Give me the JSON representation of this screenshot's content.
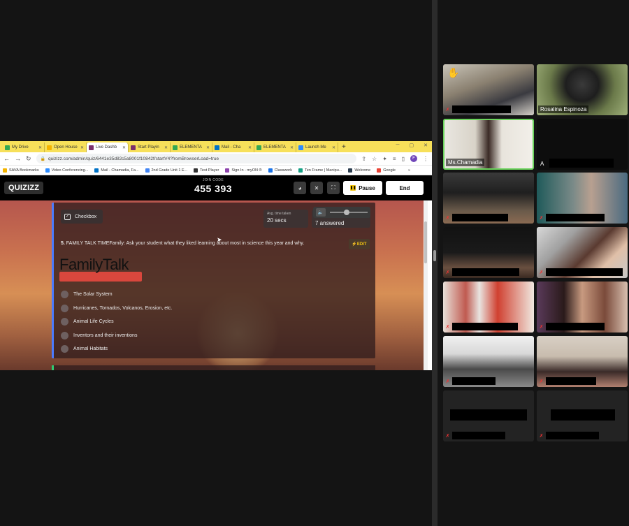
{
  "browser": {
    "tabs": [
      {
        "label": "My Drive",
        "color": "#34a853",
        "active": false
      },
      {
        "label": "Open House",
        "color": "#f4b400",
        "active": false
      },
      {
        "label": "Live Dashb",
        "color": "#7b2f6b",
        "active": true
      },
      {
        "label": "Start Playin",
        "color": "#7b2f6b",
        "active": false
      },
      {
        "label": "ELEMENTA",
        "color": "#34a853",
        "active": false
      },
      {
        "label": "Mail - Cha",
        "color": "#0072c6",
        "active": false
      },
      {
        "label": "ELEMENTA",
        "color": "#34a853",
        "active": false
      },
      {
        "label": "Launch Me",
        "color": "#2d8cff",
        "active": false
      }
    ],
    "new_tab": "+",
    "url": "quizizz.com/admin/quiz/6441e35d82c5a8001f10842f/startV4?fromBrowserLoad=true",
    "profile_initial": "F",
    "bookmarks": [
      {
        "label": "SAVA Bookmarks",
        "color": "#f4b400"
      },
      {
        "label": "Video Conferencing...",
        "color": "#2d8cff"
      },
      {
        "label": "Mail - Chamadia, Fa...",
        "color": "#0072c6"
      },
      {
        "label": "2nd Grade Unit 1 E...",
        "color": "#4285f4"
      },
      {
        "label": "Test Player",
        "color": "#333333"
      },
      {
        "label": "Sign In - myON ®",
        "color": "#8e44ad"
      },
      {
        "label": "Classwork",
        "color": "#1a73e8"
      },
      {
        "label": "Ten Frame | Manipu...",
        "color": "#16a085"
      },
      {
        "label": "Welcome",
        "color": "#2c3e50"
      },
      {
        "label": "Google",
        "color": "#ea4335"
      },
      {
        "label": "»",
        "color": "#ffffff"
      }
    ]
  },
  "quizizz": {
    "logo": "QUIZIZZ",
    "join_label": "JOIN CODE",
    "join_code": "455 393",
    "pause_label": "Pause",
    "end_label": "End",
    "question_type": "Checkbox",
    "avg_label": "Avg. time taken",
    "avg_value": "20 secs",
    "answered": "7 answered",
    "question_number": "5.",
    "question_text": "FAMILY TALK TIMEFamily: Ask your student what they liked learning about most in science this year and why.",
    "edit_label": "EDIT",
    "image_title": "FamilyTalk",
    "options": [
      "The Solar System",
      "Hurricanes, Tornados, Volcanos, Erosion, etc.",
      "Animal Life Cycles",
      "Inventors and their inventions",
      "Animal Habitats"
    ]
  },
  "gallery": {
    "participants": [
      {
        "name": "",
        "hand": true
      },
      {
        "name": "Rosalina Espinoza"
      },
      {
        "name": "Ms.Chamadia",
        "active": true
      },
      {
        "name": "A"
      }
    ]
  }
}
